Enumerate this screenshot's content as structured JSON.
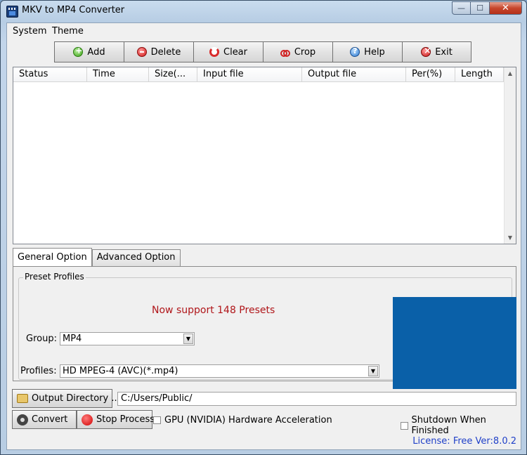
{
  "window": {
    "title": "MKV to MP4 Converter",
    "controls": {
      "minimize": "—",
      "maximize": "☐",
      "close": "✕"
    }
  },
  "menu": {
    "items": [
      "System",
      "Theme"
    ]
  },
  "toolbar": {
    "buttons": [
      {
        "label": "Add",
        "icon": "add-icon"
      },
      {
        "label": "Delete",
        "icon": "delete-icon"
      },
      {
        "label": "Clear",
        "icon": "clear-icon"
      },
      {
        "label": "Crop",
        "icon": "crop-icon"
      },
      {
        "label": "Help",
        "icon": "help-icon"
      },
      {
        "label": "Exit",
        "icon": "exit-icon"
      }
    ]
  },
  "list": {
    "columns": [
      "Status",
      "Time",
      "Size(...",
      "Input file",
      "Output file",
      "Per(%)",
      "Length"
    ],
    "scroll_up": "▲",
    "scroll_down": "▼"
  },
  "tabs": [
    "General Option",
    "Advanced Option"
  ],
  "preset": {
    "legend": "Preset Profiles",
    "support_text": "Now support 148 Presets",
    "group_label": "Group:",
    "group_value": "MP4",
    "profiles_label": "Profiles:",
    "profiles_value": "HD MPEG-4 (AVC)(*.mp4)",
    "dropdown_glyph": "▼",
    "preview_color": "#0a60a8"
  },
  "bottom": {
    "output_dir_button": "Output Directory ...",
    "output_dir_value": "C:/Users/Public/",
    "convert_button": "Convert",
    "stop_button": "Stop Process",
    "gpu_label": "GPU (NVIDIA) Hardware Acceleration",
    "gpu_checked": false,
    "shutdown_label": "Shutdown When Finished",
    "shutdown_checked": false,
    "license": "License: Free Ver:8.0.2"
  }
}
